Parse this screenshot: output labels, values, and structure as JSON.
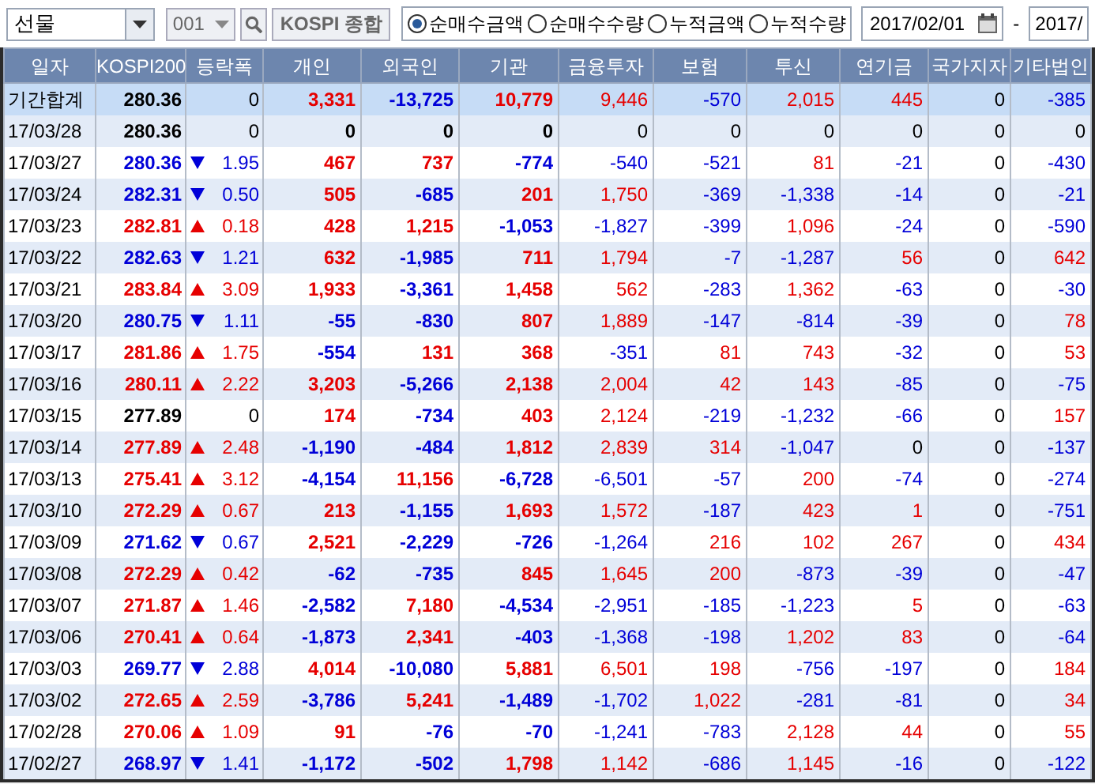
{
  "toolbar": {
    "market": "선물",
    "code": "001",
    "index_button": "KOSPI 종합",
    "radios": [
      {
        "label": "순매수금액",
        "selected": true
      },
      {
        "label": "순매수수량",
        "selected": false
      },
      {
        "label": "누적금액",
        "selected": false
      },
      {
        "label": "누적수량",
        "selected": false
      }
    ],
    "date_from": "2017/02/01",
    "date_separator": "-",
    "date_to": "2017/"
  },
  "table": {
    "columns": [
      "일자",
      "KOSPI200",
      "등락폭",
      "개인",
      "외국인",
      "기관",
      "금융투자",
      "보험",
      "투신",
      "연기금",
      "국가지자",
      "기타법인"
    ],
    "rows": [
      {
        "kind": "total",
        "date": "기간합계",
        "kospi": "280.36",
        "rising": false,
        "falling": false,
        "change": "0",
        "values": [
          "3,331",
          "-13,725",
          "10,779",
          "9,446",
          "-570",
          "2,015",
          "445",
          "0",
          "-385"
        ]
      },
      {
        "kind": "day",
        "date": "17/03/28",
        "kospi": "280.36",
        "rising": false,
        "falling": false,
        "change": "0",
        "values": [
          "0",
          "0",
          "0",
          "0",
          "0",
          "0",
          "0",
          "0",
          "0"
        ]
      },
      {
        "kind": "day",
        "date": "17/03/27",
        "kospi": "280.36",
        "rising": false,
        "falling": true,
        "change": "1.95",
        "values": [
          "467",
          "737",
          "-774",
          "-540",
          "-521",
          "81",
          "-21",
          "0",
          "-430"
        ]
      },
      {
        "kind": "day",
        "date": "17/03/24",
        "kospi": "282.31",
        "rising": false,
        "falling": true,
        "change": "0.50",
        "values": [
          "505",
          "-685",
          "201",
          "1,750",
          "-369",
          "-1,338",
          "-14",
          "0",
          "-21"
        ]
      },
      {
        "kind": "day",
        "date": "17/03/23",
        "kospi": "282.81",
        "rising": true,
        "falling": false,
        "change": "0.18",
        "values": [
          "428",
          "1,215",
          "-1,053",
          "-1,827",
          "-399",
          "1,096",
          "-24",
          "0",
          "-590"
        ]
      },
      {
        "kind": "day",
        "date": "17/03/22",
        "kospi": "282.63",
        "rising": false,
        "falling": true,
        "change": "1.21",
        "values": [
          "632",
          "-1,985",
          "711",
          "1,794",
          "-7",
          "-1,287",
          "56",
          "0",
          "642"
        ]
      },
      {
        "kind": "day",
        "date": "17/03/21",
        "kospi": "283.84",
        "rising": true,
        "falling": false,
        "change": "3.09",
        "values": [
          "1,933",
          "-3,361",
          "1,458",
          "562",
          "-283",
          "1,362",
          "-63",
          "0",
          "-30"
        ]
      },
      {
        "kind": "day",
        "date": "17/03/20",
        "kospi": "280.75",
        "rising": false,
        "falling": true,
        "change": "1.11",
        "values": [
          "-55",
          "-830",
          "807",
          "1,889",
          "-147",
          "-814",
          "-39",
          "0",
          "78"
        ]
      },
      {
        "kind": "day",
        "date": "17/03/17",
        "kospi": "281.86",
        "rising": true,
        "falling": false,
        "change": "1.75",
        "values": [
          "-554",
          "131",
          "368",
          "-351",
          "81",
          "743",
          "-32",
          "0",
          "53"
        ]
      },
      {
        "kind": "day",
        "date": "17/03/16",
        "kospi": "280.11",
        "rising": true,
        "falling": false,
        "change": "2.22",
        "values": [
          "3,203",
          "-5,266",
          "2,138",
          "2,004",
          "42",
          "143",
          "-85",
          "0",
          "-75"
        ]
      },
      {
        "kind": "day",
        "date": "17/03/15",
        "kospi": "277.89",
        "rising": false,
        "falling": false,
        "change": "0",
        "values": [
          "174",
          "-734",
          "403",
          "2,124",
          "-219",
          "-1,232",
          "-66",
          "0",
          "157"
        ]
      },
      {
        "kind": "day",
        "date": "17/03/14",
        "kospi": "277.89",
        "rising": true,
        "falling": false,
        "change": "2.48",
        "values": [
          "-1,190",
          "-484",
          "1,812",
          "2,839",
          "314",
          "-1,047",
          "0",
          "0",
          "-137"
        ]
      },
      {
        "kind": "day",
        "date": "17/03/13",
        "kospi": "275.41",
        "rising": true,
        "falling": false,
        "change": "3.12",
        "values": [
          "-4,154",
          "11,156",
          "-6,728",
          "-6,501",
          "-57",
          "200",
          "-74",
          "0",
          "-274"
        ]
      },
      {
        "kind": "day",
        "date": "17/03/10",
        "kospi": "272.29",
        "rising": true,
        "falling": false,
        "change": "0.67",
        "values": [
          "213",
          "-1,155",
          "1,693",
          "1,572",
          "-187",
          "423",
          "1",
          "0",
          "-751"
        ]
      },
      {
        "kind": "day",
        "date": "17/03/09",
        "kospi": "271.62",
        "rising": false,
        "falling": true,
        "change": "0.67",
        "values": [
          "2,521",
          "-2,229",
          "-726",
          "-1,264",
          "216",
          "102",
          "267",
          "0",
          "434"
        ]
      },
      {
        "kind": "day",
        "date": "17/03/08",
        "kospi": "272.29",
        "rising": true,
        "falling": false,
        "change": "0.42",
        "values": [
          "-62",
          "-735",
          "845",
          "1,645",
          "200",
          "-873",
          "-39",
          "0",
          "-47"
        ]
      },
      {
        "kind": "day",
        "date": "17/03/07",
        "kospi": "271.87",
        "rising": true,
        "falling": false,
        "change": "1.46",
        "values": [
          "-2,582",
          "7,180",
          "-4,534",
          "-2,951",
          "-185",
          "-1,223",
          "5",
          "0",
          "-63"
        ]
      },
      {
        "kind": "day",
        "date": "17/03/06",
        "kospi": "270.41",
        "rising": true,
        "falling": false,
        "change": "0.64",
        "values": [
          "-1,873",
          "2,341",
          "-403",
          "-1,368",
          "-198",
          "1,202",
          "83",
          "0",
          "-64"
        ]
      },
      {
        "kind": "day",
        "date": "17/03/03",
        "kospi": "269.77",
        "rising": false,
        "falling": true,
        "change": "2.88",
        "values": [
          "4,014",
          "-10,080",
          "5,881",
          "6,501",
          "198",
          "-756",
          "-197",
          "0",
          "184"
        ]
      },
      {
        "kind": "day",
        "date": "17/03/02",
        "kospi": "272.65",
        "rising": true,
        "falling": false,
        "change": "2.59",
        "values": [
          "-3,786",
          "5,241",
          "-1,489",
          "-1,702",
          "1,022",
          "-281",
          "-81",
          "0",
          "34"
        ]
      },
      {
        "kind": "day",
        "date": "17/02/28",
        "kospi": "270.06",
        "rising": true,
        "falling": false,
        "change": "1.09",
        "values": [
          "91",
          "-76",
          "-70",
          "-1,241",
          "-783",
          "2,128",
          "44",
          "0",
          "55"
        ]
      },
      {
        "kind": "day",
        "date": "17/02/27",
        "kospi": "268.97",
        "rising": false,
        "falling": true,
        "change": "1.41",
        "values": [
          "-1,172",
          "-502",
          "1,798",
          "1,142",
          "-686",
          "1,145",
          "-16",
          "0",
          "-122"
        ]
      }
    ]
  }
}
